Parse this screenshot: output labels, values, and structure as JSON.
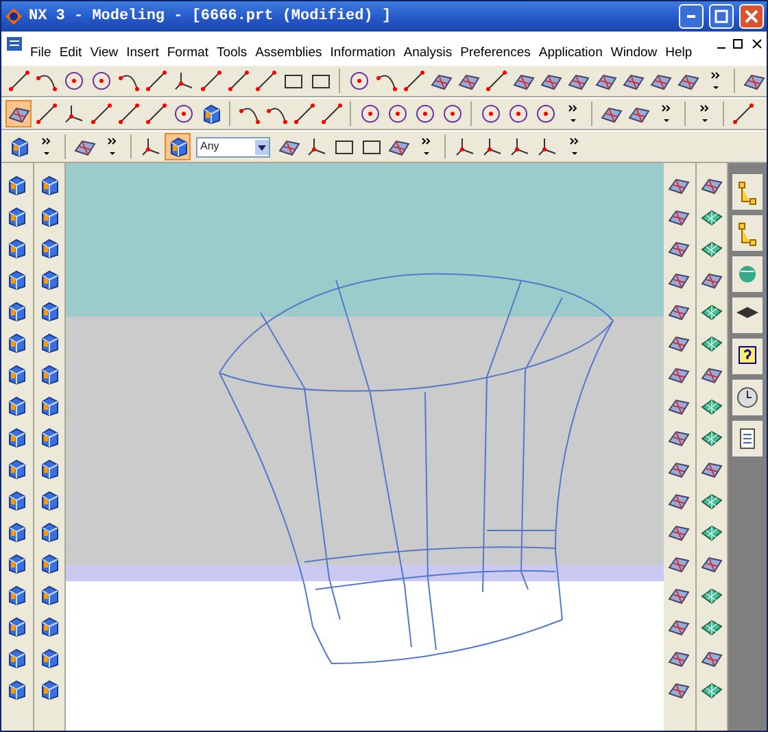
{
  "window": {
    "title": "NX 3 - Modeling - [6666.prt (Modified) ]"
  },
  "menu": [
    {
      "label": "File"
    },
    {
      "label": "Edit"
    },
    {
      "label": "View"
    },
    {
      "label": "Insert"
    },
    {
      "label": "Format"
    },
    {
      "label": "Tools"
    },
    {
      "label": "Assemblies"
    },
    {
      "label": "Information"
    },
    {
      "label": "Analysis"
    },
    {
      "label": "Preferences"
    },
    {
      "label": "Application"
    },
    {
      "label": "Window"
    },
    {
      "label": "Help"
    }
  ],
  "selection_filter": {
    "value": "Any"
  }
}
